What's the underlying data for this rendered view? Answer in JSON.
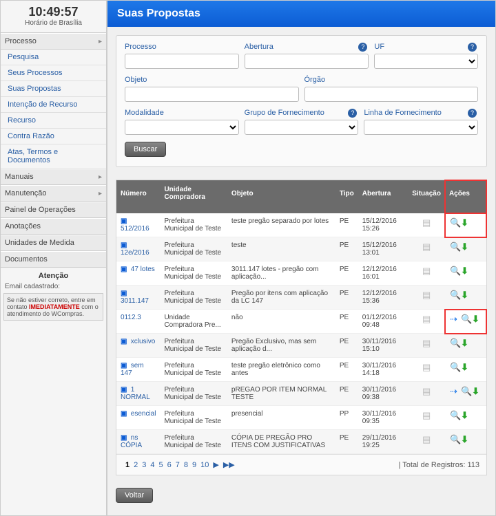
{
  "clock": {
    "time": "10:49:57",
    "tz": "Horário de Brasília"
  },
  "sidebar": {
    "sections": [
      {
        "title": "Processo",
        "items": [
          "Pesquisa",
          "Seus Processos",
          "Suas Propostas",
          "Intenção de Recurso",
          "Recurso",
          "Contra Razão",
          "Atas, Termos e Documentos"
        ]
      },
      {
        "title": "Manuais",
        "items": []
      },
      {
        "title": "Manutenção",
        "items": []
      }
    ],
    "singles": [
      "Painel de Operações",
      "Anotações",
      "Unidades de Medida",
      "Documentos"
    ],
    "attention_title": "Atenção",
    "attention_sub": "Email cadastrado:",
    "attention_note_pre": "Se não estiver correto, entre em contato ",
    "attention_note_bold": "IMEDIATAMENTE",
    "attention_note_post": " com o atendimento do WCompras."
  },
  "page": {
    "title": "Suas Propostas"
  },
  "filters": {
    "processo": "Processo",
    "abertura": "Abertura",
    "uf": "UF",
    "objeto": "Objeto",
    "orgao": "Órgão",
    "modalidade": "Modalidade",
    "grupo": "Grupo de Fornecimento",
    "linha": "Linha de Fornecimento",
    "buscar": "Buscar",
    "voltar": "Voltar"
  },
  "table": {
    "headers": {
      "numero": "Número",
      "unidade": "Unidade Compradora",
      "objeto": "Objeto",
      "tipo": "Tipo",
      "abertura": "Abertura",
      "situacao": "Situação",
      "acoes": "Ações"
    },
    "rows": [
      {
        "num": "512/2016",
        "uni": "Prefeitura Municipal de Teste",
        "obj": "teste pregão separado por lotes",
        "tipo": "PE",
        "abert": "15/12/2016 15:26",
        "hl": true
      },
      {
        "num": "12e/2016",
        "uni": "Prefeitura Municipal de Teste",
        "obj": "teste",
        "tipo": "PE",
        "abert": "15/12/2016 13:01"
      },
      {
        "num": "47 lotes",
        "uni": "Prefeitura Municipal de Teste",
        "obj": "3011.147 lotes - pregão com aplicação...",
        "tipo": "PE",
        "abert": "12/12/2016 16:01"
      },
      {
        "num": "3011.147",
        "uni": "Prefeitura Municipal de Teste",
        "obj": "Pregão por itens com aplicação da LC 147",
        "tipo": "PE",
        "abert": "12/12/2016 15:36"
      },
      {
        "num": "0112.3",
        "uni": "Unidade Compradora Pre...",
        "obj": "não",
        "tipo": "PE",
        "abert": "01/12/2016 09:48",
        "hl": true,
        "extra": true,
        "noplus": true
      },
      {
        "num": "xclusivo",
        "uni": "Prefeitura Municipal de Teste",
        "obj": "Pregão Exclusivo, mas sem aplicação d...",
        "tipo": "PE",
        "abert": "30/11/2016 15:10"
      },
      {
        "num": "sem 147",
        "uni": "Prefeitura Municipal de Teste",
        "obj": "teste pregão eletrônico como antes",
        "tipo": "PE",
        "abert": "30/11/2016 14:18"
      },
      {
        "num": "1 NORMAL",
        "uni": "Prefeitura Municipal de Teste",
        "obj": "pREGAO POR ITEM NORMAL TESTE",
        "tipo": "PE",
        "abert": "30/11/2016 09:38",
        "extra": true
      },
      {
        "num": "esencial",
        "uni": "Prefeitura Municipal de Teste",
        "obj": "presencial",
        "tipo": "PP",
        "abert": "30/11/2016 09:35"
      },
      {
        "num": "ns CÓPIA",
        "uni": "Prefeitura Municipal de Teste",
        "obj": "CÓPIA DE PREGÃO PRO ITENS COM JUSTIFICATIVAS",
        "tipo": "PE",
        "abert": "29/11/2016 19:25"
      }
    ],
    "pages": [
      "1",
      "2",
      "3",
      "4",
      "5",
      "6",
      "7",
      "8",
      "9",
      "10"
    ],
    "total_label": "| Total de Registros: 113"
  }
}
